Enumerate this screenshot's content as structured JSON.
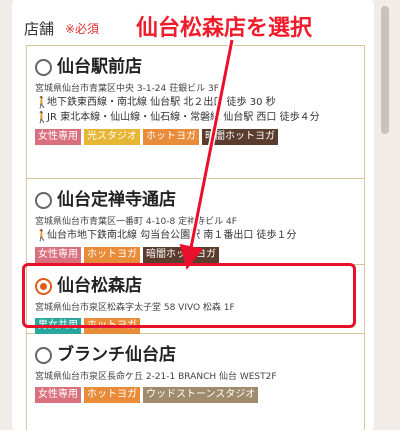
{
  "form": {
    "label": "店舗",
    "required": "※必須"
  },
  "annotation": {
    "banner": "仙台松森店を選択"
  },
  "stores": [
    {
      "name": "仙台駅前店",
      "address": "宮城県仙台市青葉区中央 3-1-24 荘銀ビル 3F",
      "access": [
        "地下鉄東西線・南北線 仙台駅 北２出口 徒歩 30 秒",
        "JR 東北本線・仙山線・仙石線・常磐線 仙台駅 西口 徒歩４分"
      ],
      "tags": [
        "女性専用",
        "光スタジオ",
        "ホットヨガ",
        "暗闇ホットヨガ"
      ],
      "selected": false
    },
    {
      "name": "仙台定禅寺通店",
      "address": "宮城県仙台市青葉区一番町 4-10-8 定禅寺ビル 4F",
      "access": [
        "仙台市地下鉄南北線 勾当台公園駅 南１番出口 徒歩１分"
      ],
      "tags": [
        "女性専用",
        "ホットヨガ",
        "暗闇ホットヨガ"
      ],
      "selected": false
    },
    {
      "name": "仙台松森店",
      "address": "宮城県仙台市泉区松森字太子堂 58 VIVO 松森 1F",
      "access": [],
      "tags": [
        "男女共用",
        "ホットヨガ"
      ],
      "selected": true
    },
    {
      "name": "ブランチ仙台店",
      "address": "宮城県仙台市泉区長命ケ丘 2-21-1 BRANCH 仙台 WEST2F",
      "access": [],
      "tags": [
        "女性専用",
        "ホットヨガ",
        "ウッドストーンスタジオ"
      ],
      "selected": false
    }
  ],
  "colors": {
    "accent": "#e25a1c",
    "highlight": "#e8102a",
    "border": "#d8c39a"
  }
}
